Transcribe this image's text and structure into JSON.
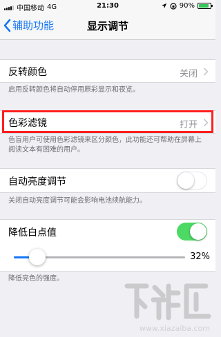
{
  "status_bar": {
    "carrier": "中国移动",
    "network": "4G",
    "time": "21:30",
    "battery": "90%",
    "battery_level": 0.9
  },
  "nav": {
    "back_label": "辅助功能",
    "title": "显示调节"
  },
  "invert_colors": {
    "label": "反转颜色",
    "value": "关闭",
    "footer": "启用反转颜色将自动停用原彩显示和夜览。"
  },
  "color_filters": {
    "label": "色彩滤镜",
    "value": "打开",
    "footer": "色盲用户可使用色彩滤镜来区分颜色，此功能还可帮助在屏幕上阅读文本有困难的用户。"
  },
  "auto_brightness": {
    "label": "自动亮度调节",
    "enabled": false,
    "footer": "关闭自动亮度调节可能会影响电池续航能力。"
  },
  "reduce_white_point": {
    "label": "降低白点值",
    "enabled": true,
    "percent_label": "32%",
    "percent": 0.32,
    "footer": "降低亮色的强度。"
  },
  "colors": {
    "accent": "#1477f8",
    "toggle_on": "#4cd964",
    "highlight": "#ff1e1e"
  },
  "watermark": {
    "text": "www.xiazaiba.com"
  }
}
